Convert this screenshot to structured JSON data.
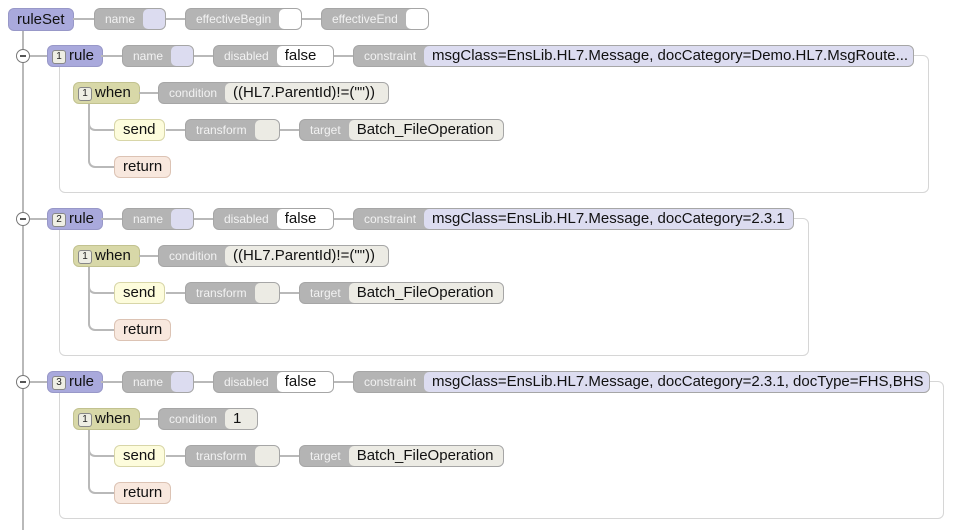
{
  "ruleSet": {
    "label": "ruleSet",
    "attrs": {
      "name": {
        "label": "name",
        "value": ""
      },
      "effectiveBegin": {
        "label": "effectiveBegin",
        "value": ""
      },
      "effectiveEnd": {
        "label": "effectiveEnd",
        "value": ""
      }
    }
  },
  "rules": [
    {
      "index": "1",
      "label": "rule",
      "name": {
        "label": "name",
        "value": ""
      },
      "disabled": {
        "label": "disabled",
        "value": "false"
      },
      "constraint": {
        "label": "constraint",
        "value": "msgClass=EnsLib.HL7.Message, docCategory=Demo.HL7.MsgRoute..."
      },
      "when": {
        "index": "1",
        "label": "when",
        "condition": {
          "label": "condition",
          "value": "((HL7.ParentId)!=(\"\"))"
        }
      },
      "send": {
        "label": "send",
        "transform": {
          "label": "transform",
          "value": ""
        },
        "target": {
          "label": "target",
          "value": "Batch_FileOperation"
        }
      },
      "return": {
        "label": "return"
      }
    },
    {
      "index": "2",
      "label": "rule",
      "name": {
        "label": "name",
        "value": ""
      },
      "disabled": {
        "label": "disabled",
        "value": "false"
      },
      "constraint": {
        "label": "constraint",
        "value": "msgClass=EnsLib.HL7.Message, docCategory=2.3.1"
      },
      "when": {
        "index": "1",
        "label": "when",
        "condition": {
          "label": "condition",
          "value": "((HL7.ParentId)!=(\"\"))"
        }
      },
      "send": {
        "label": "send",
        "transform": {
          "label": "transform",
          "value": ""
        },
        "target": {
          "label": "target",
          "value": "Batch_FileOperation"
        }
      },
      "return": {
        "label": "return"
      }
    },
    {
      "index": "3",
      "label": "rule",
      "name": {
        "label": "name",
        "value": ""
      },
      "disabled": {
        "label": "disabled",
        "value": "false"
      },
      "constraint": {
        "label": "constraint",
        "value": "msgClass=EnsLib.HL7.Message, docCategory=2.3.1, docType=FHS,BHS"
      },
      "when": {
        "index": "1",
        "label": "when",
        "condition": {
          "label": "condition",
          "value": "1"
        }
      },
      "send": {
        "label": "send",
        "transform": {
          "label": "transform",
          "value": ""
        },
        "target": {
          "label": "target",
          "value": "Batch_FileOperation"
        }
      },
      "return": {
        "label": "return"
      }
    }
  ]
}
